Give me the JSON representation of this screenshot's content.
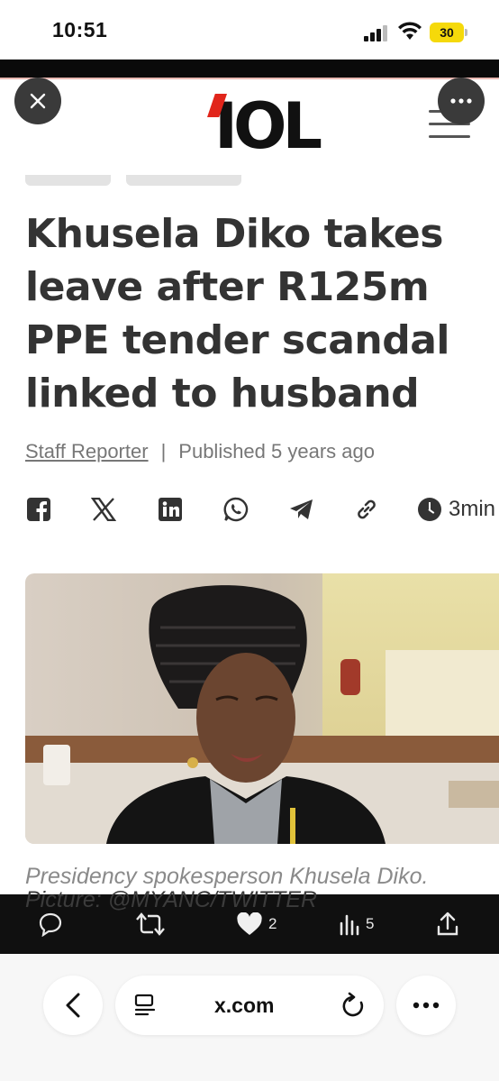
{
  "status_bar": {
    "time": "10:51",
    "battery": "30",
    "battery_color": "#f5d90a"
  },
  "site": {
    "logo": "IOL",
    "logo_accent_color": "#e1251b",
    "close_icon": "close-icon",
    "more_icon": "more-icon",
    "menu_icon": "hamburger-icon"
  },
  "article": {
    "headline": "Khusela Diko takes leave after R125m PPE tender scandal linked to husband",
    "author": "Staff Reporter",
    "separator": "|",
    "published": "Published 5 years ago",
    "read_time": "3min",
    "share_icons": [
      "facebook-icon",
      "x-icon",
      "linkedin-icon",
      "whatsapp-icon",
      "telegram-icon",
      "link-icon"
    ],
    "caption_line1": "Presidency spokesperson Khusela Diko.",
    "caption_line2": "Picture: @MYANC/TWITTER"
  },
  "tweet_actions": {
    "reply_icon": "reply-icon",
    "retweet_icon": "retweet-icon",
    "like_count": "2",
    "views_count": "5",
    "share_icon": "share-icon"
  },
  "browser": {
    "url": "x.com",
    "back_icon": "back-icon",
    "reader_icon": "reader-icon",
    "reload_icon": "reload-icon",
    "more_icon": "more-icon"
  }
}
